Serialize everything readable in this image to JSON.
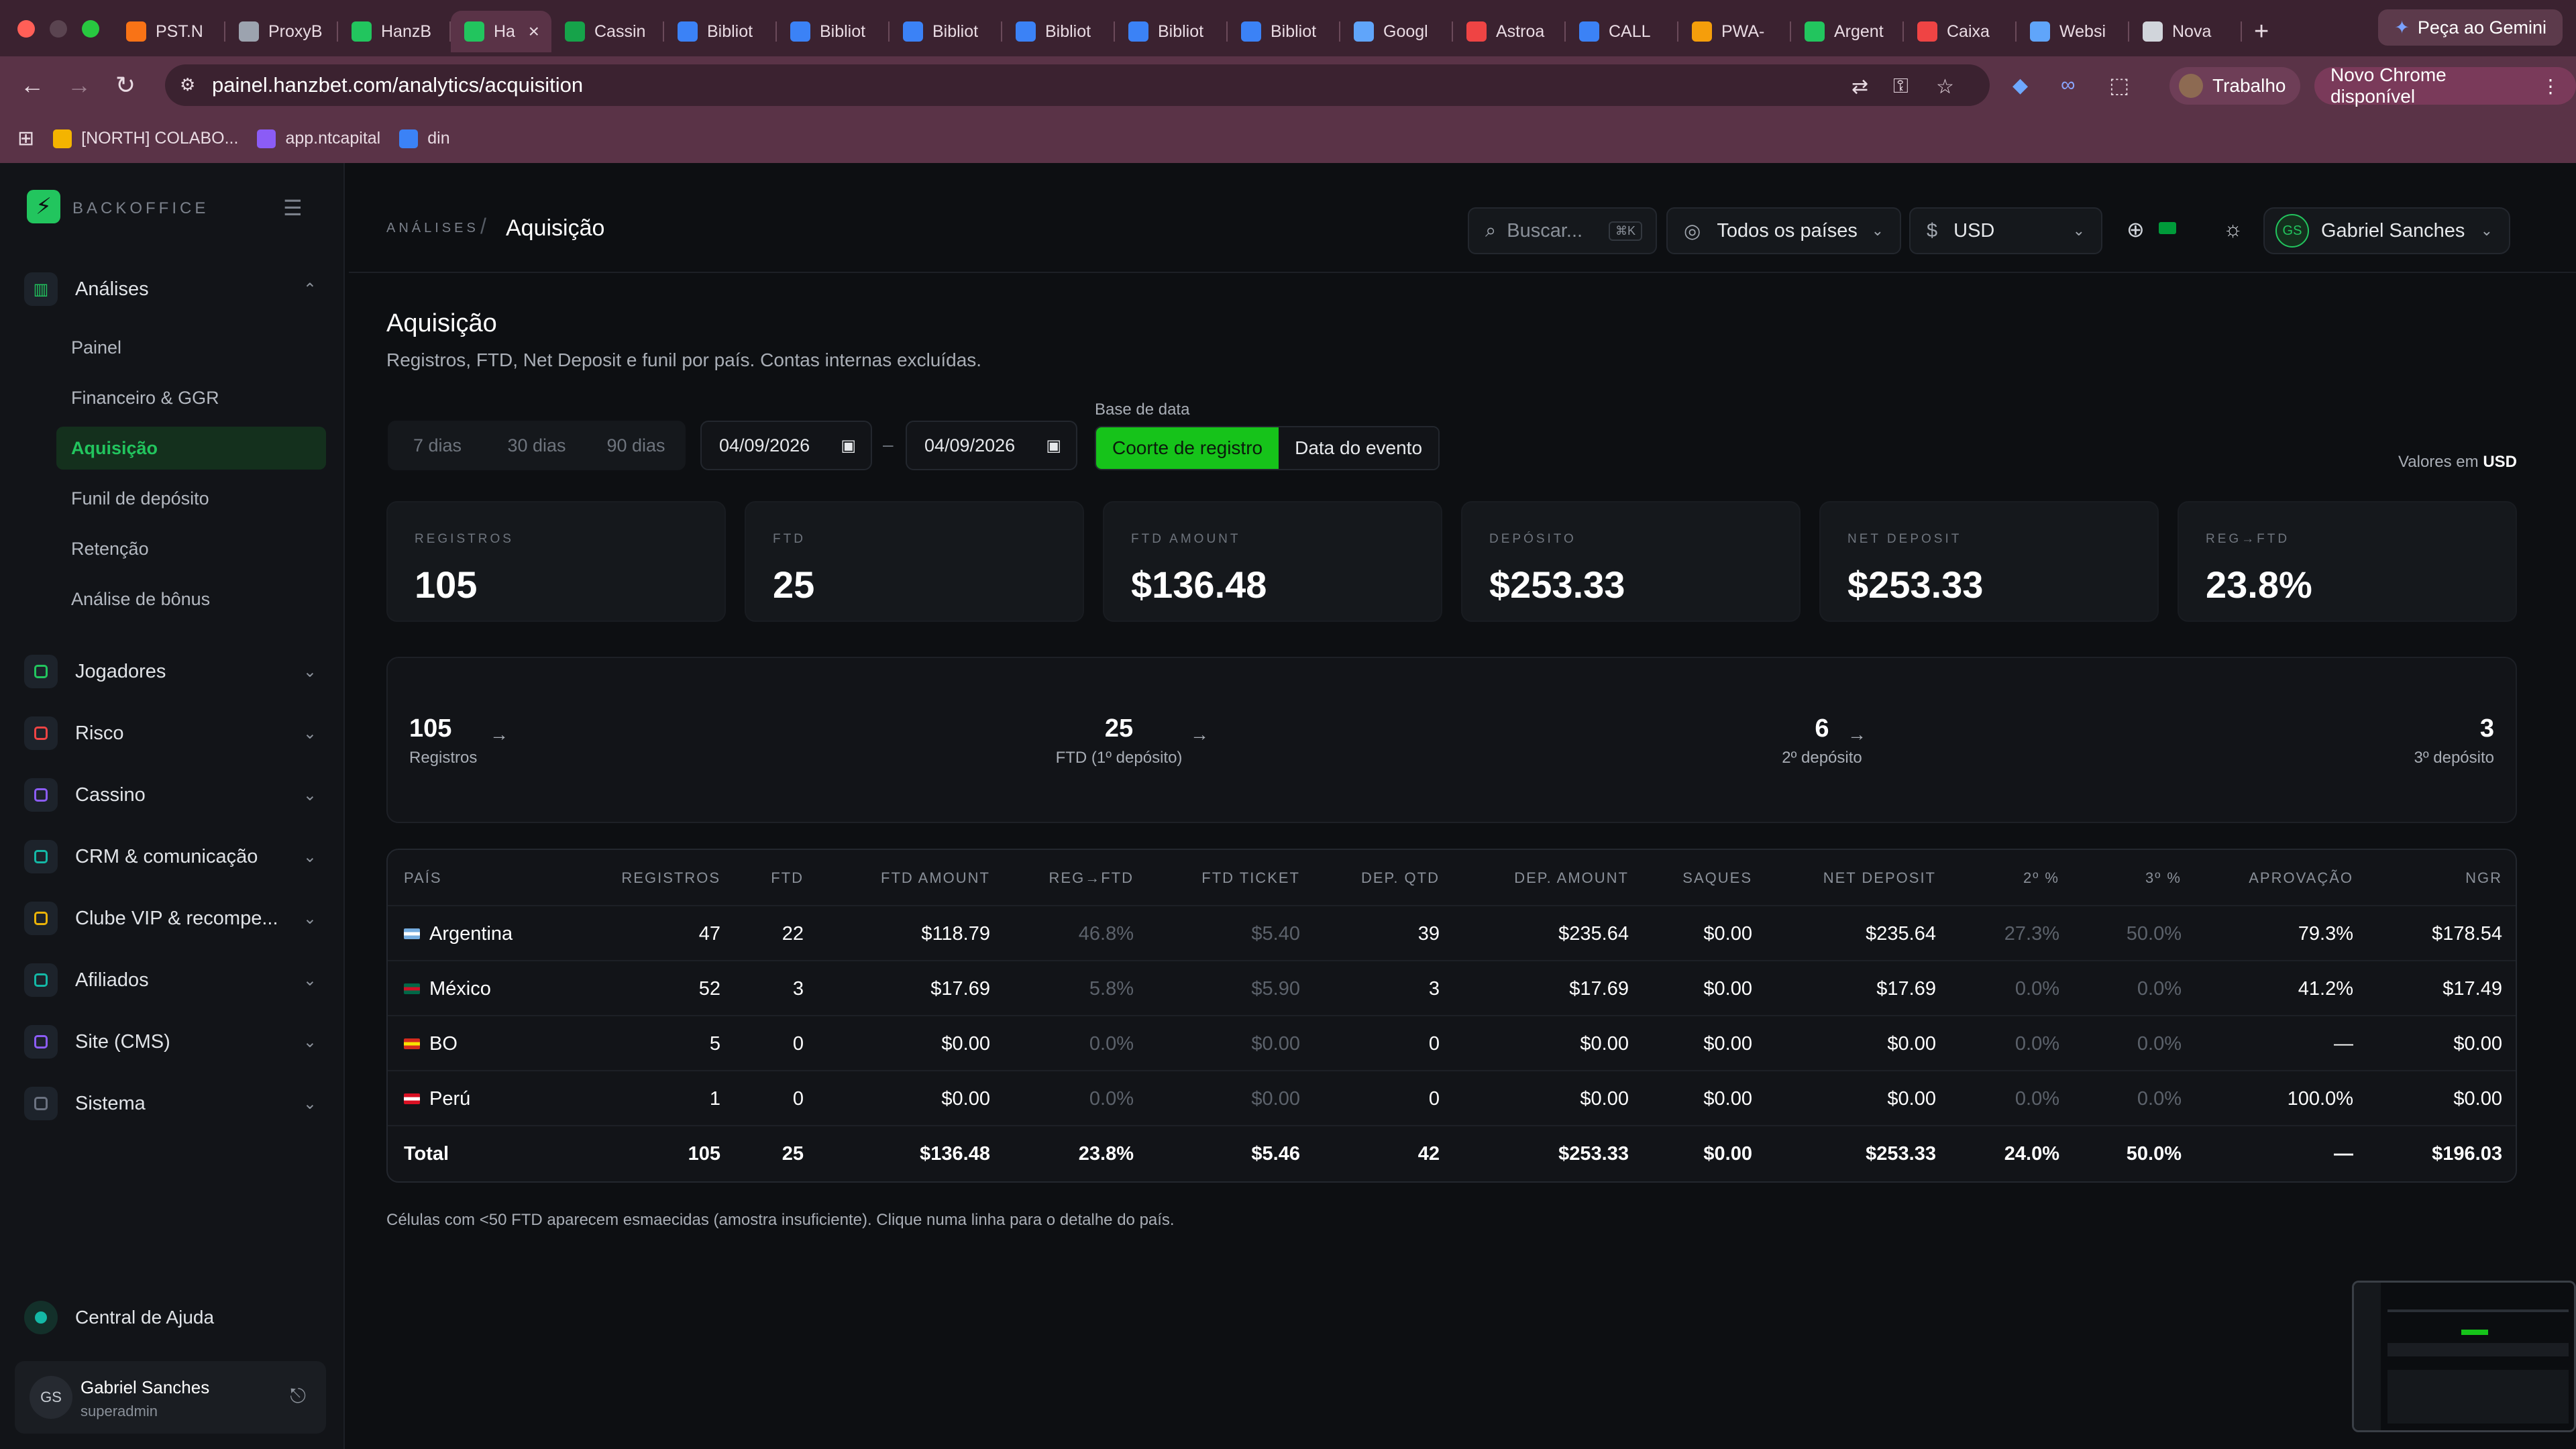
{
  "browser": {
    "tabs": [
      {
        "label": "PST.N",
        "color": "#f97316",
        "icon": "fire-icon"
      },
      {
        "label": "ProxyB",
        "color": "#9ca3af",
        "icon": "proxy-icon"
      },
      {
        "label": "HanzB",
        "color": "#22c55e",
        "icon": "hanz-icon"
      },
      {
        "label": "Ha",
        "color": "#22c55e",
        "icon": "hanz-icon",
        "active": true
      },
      {
        "label": "Cassin",
        "color": "#16a34a",
        "icon": "sheets-icon"
      },
      {
        "label": "Bibliot",
        "color": "#3b82f6",
        "icon": "meta-icon"
      },
      {
        "label": "Bibliot",
        "color": "#3b82f6",
        "icon": "meta-icon"
      },
      {
        "label": "Bibliot",
        "color": "#3b82f6",
        "icon": "meta-icon"
      },
      {
        "label": "Bibliot",
        "color": "#3b82f6",
        "icon": "meta-icon"
      },
      {
        "label": "Bibliot",
        "color": "#3b82f6",
        "icon": "meta-icon"
      },
      {
        "label": "Bibliot",
        "color": "#3b82f6",
        "icon": "meta-icon"
      },
      {
        "label": "Googl",
        "color": "#60a5fa",
        "icon": "google-ads-icon"
      },
      {
        "label": "Astroa",
        "color": "#ef4444",
        "icon": "gmail-icon"
      },
      {
        "label": "CALL",
        "color": "#3b82f6",
        "icon": "docs-icon"
      },
      {
        "label": "PWA-",
        "color": "#f59e0b",
        "icon": "firebase-icon"
      },
      {
        "label": "Argent",
        "color": "#22c55e",
        "icon": "drive-icon"
      },
      {
        "label": "Caixa",
        "color": "#ef4444",
        "icon": "gmail-icon"
      },
      {
        "label": "Websi",
        "color": "#60a5fa",
        "icon": "web-icon"
      },
      {
        "label": "Nova",
        "color": "#d1d5db",
        "icon": "chrome-icon"
      }
    ],
    "gemini_label": "Peça ao Gemini",
    "url": "painel.hanzbet.com/analytics/acquisition",
    "profile_label": "Trabalho",
    "update_label": "Novo Chrome disponível",
    "bookmarks": [
      {
        "label": "[NORTH] COLABO...",
        "color": "#f4b400"
      },
      {
        "label": "app.ntcapital",
        "color": "#8b5cf6"
      },
      {
        "label": "din",
        "color": "#3b82f6"
      }
    ]
  },
  "sidebar": {
    "brand": "BACKOFFICE",
    "analises_label": "Análises",
    "subitems": [
      "Painel",
      "Financeiro & GGR",
      "Aquisição",
      "Funil de depósito",
      "Retenção",
      "Análise de bônus"
    ],
    "groups": [
      {
        "label": "Jogadores",
        "color": "#22c55e",
        "icon": "players-icon"
      },
      {
        "label": "Risco",
        "color": "#ef4444",
        "icon": "shield-icon"
      },
      {
        "label": "Cassino",
        "color": "#8b5cf6",
        "icon": "gamepad-icon"
      },
      {
        "label": "CRM & comunicação",
        "color": "#14b8a6",
        "icon": "crm-icon"
      },
      {
        "label": "Clube VIP & recompe...",
        "color": "#eab308",
        "icon": "trophy-icon"
      },
      {
        "label": "Afiliados",
        "color": "#14b8a6",
        "icon": "affiliates-icon"
      },
      {
        "label": "Site (CMS)",
        "color": "#8b5cf6",
        "icon": "cms-icon"
      },
      {
        "label": "Sistema",
        "color": "#6b7280",
        "icon": "gear-icon"
      }
    ],
    "help_label": "Central de Ajuda",
    "user_initials": "GS",
    "user_name": "Gabriel Sanches",
    "user_role": "superadmin"
  },
  "topbar": {
    "breadcrumb_parent": "ANÁLISES",
    "breadcrumb_current": "Aquisição",
    "search_placeholder": "Buscar...",
    "search_kbd": "⌘K",
    "country_filter": "Todos os países",
    "currency_symbol": "$",
    "currency": "USD",
    "user_initials": "GS",
    "user_name": "Gabriel Sanches"
  },
  "page": {
    "title": "Aquisição",
    "subtitle": "Registros, FTD, Net Deposit e funil por país. Contas internas excluídas.",
    "ranges": [
      "7 dias",
      "30 dias",
      "90 dias"
    ],
    "date_from": "04/09/2026",
    "date_to": "04/09/2026",
    "date_sep": "–",
    "base_label": "Base de data",
    "base_options": [
      "Coorte de registro",
      "Data do evento"
    ],
    "values_in_prefix": "Valores em",
    "values_in_currency": "USD"
  },
  "kpis": [
    {
      "label": "REGISTROS",
      "value": "105"
    },
    {
      "label": "FTD",
      "value": "25"
    },
    {
      "label": "FTD AMOUNT",
      "value": "$136.48"
    },
    {
      "label": "DEPÓSITO",
      "value": "$253.33"
    },
    {
      "label": "NET DEPOSIT",
      "value": "$253.33"
    },
    {
      "label": "REG→FTD",
      "value": "23.8%"
    }
  ],
  "funnel": [
    {
      "value": "105",
      "label": "Registros"
    },
    {
      "value": "25",
      "label": "FTD (1º depósito)"
    },
    {
      "value": "6",
      "label": "2º depósito"
    },
    {
      "value": "3",
      "label": "3º depósito"
    }
  ],
  "table": {
    "headers": [
      "PAÍS",
      "REGISTROS",
      "FTD",
      "FTD AMOUNT",
      "REG→FTD",
      "FTD TICKET",
      "DEP. QTD",
      "DEP. AMOUNT",
      "SAQUES",
      "NET DEPOSIT",
      "2º %",
      "3º %",
      "APROVAÇÃO",
      "NGR"
    ],
    "rows": [
      {
        "flag": [
          "#74acdf",
          "#ffffff"
        ],
        "cells": [
          "Argentina",
          "47",
          "22",
          "$118.79",
          "46.8%",
          "$5.40",
          "39",
          "$235.64",
          "$0.00",
          "$235.64",
          "27.3%",
          "50.0%",
          "79.3%",
          "$178.54"
        ]
      },
      {
        "flag": [
          "#006847",
          "#ce1126"
        ],
        "cells": [
          "México",
          "52",
          "3",
          "$17.69",
          "5.8%",
          "$5.90",
          "3",
          "$17.69",
          "$0.00",
          "$17.69",
          "0.0%",
          "0.0%",
          "41.2%",
          "$17.49"
        ]
      },
      {
        "flag": [
          "#d52b1e",
          "#f9e300"
        ],
        "cells": [
          "BO",
          "5",
          "0",
          "$0.00",
          "0.0%",
          "$0.00",
          "0",
          "$0.00",
          "$0.00",
          "$0.00",
          "0.0%",
          "0.0%",
          "—",
          "$0.00"
        ]
      },
      {
        "flag": [
          "#d91023",
          "#ffffff"
        ],
        "cells": [
          "Perú",
          "1",
          "0",
          "$0.00",
          "0.0%",
          "$0.00",
          "0",
          "$0.00",
          "$0.00",
          "$0.00",
          "0.0%",
          "0.0%",
          "100.0%",
          "$0.00"
        ]
      }
    ],
    "total": [
      "Total",
      "105",
      "25",
      "$136.48",
      "23.8%",
      "$5.46",
      "42",
      "$253.33",
      "$0.00",
      "$253.33",
      "24.0%",
      "50.0%",
      "—",
      "$196.03"
    ]
  },
  "footnote": "Células com <50 FTD aparecem esmaecidas (amostra insuficiente). Clique numa linha para o detalhe do país."
}
